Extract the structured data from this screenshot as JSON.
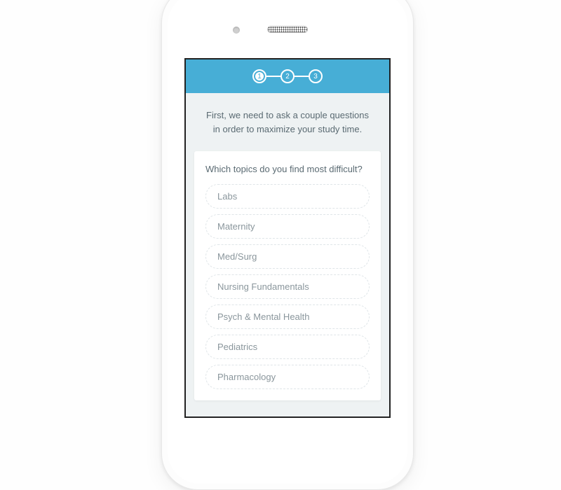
{
  "stepper": {
    "steps": [
      "1",
      "2",
      "3"
    ],
    "active_index": 0
  },
  "intro_text": "First, we need to ask a couple questions in order to maximize your study time.",
  "question": "Which topics do you find most difficult?",
  "topics": [
    "Labs",
    "Maternity",
    "Med/Surg",
    "Nursing Fundamentals",
    "Psych & Mental Health",
    "Pediatrics",
    "Pharmacology"
  ],
  "colors": {
    "header": "#47aed6",
    "screen_bg": "#eef2f3",
    "text": "#5a6a72",
    "muted": "#8a969c"
  }
}
